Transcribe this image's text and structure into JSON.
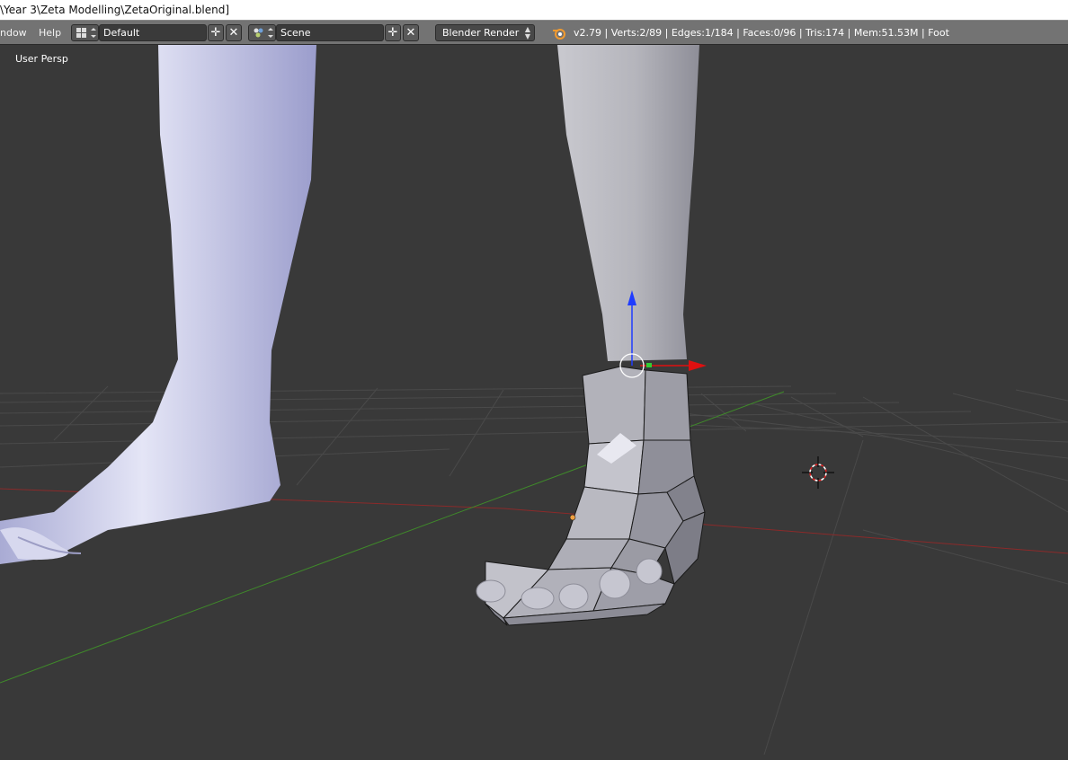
{
  "window": {
    "title": "\\Year 3\\Zeta Modelling\\ZetaOriginal.blend]"
  },
  "header": {
    "menu_window": "ndow",
    "menu_help": "Help",
    "screen_layout": "Default",
    "scene": "Scene",
    "render_engine": "Blender Render",
    "version": "v2.79",
    "stats": "Verts:2/89 | Edges:1/184 | Faces:0/96 | Tris:174 | Mem:51.53M | Foot"
  },
  "viewport": {
    "view_label": "User Persp",
    "icons": [
      "screen-layout-icon",
      "scene-icon",
      "blender-logo-icon",
      "add-icon",
      "close-icon",
      "3d-cursor-icon",
      "transform-gizmo-icon"
    ],
    "colors": {
      "background": "#393939",
      "grid": "#4a4a4a",
      "x_axis": "#8b2a2a",
      "y_axis": "#3f8a2a",
      "gizmo_z": "#1f3cff",
      "gizmo_x": "#e01010",
      "mesh": "#a9a9b8",
      "reference_leg": "#c7c8e6"
    }
  }
}
